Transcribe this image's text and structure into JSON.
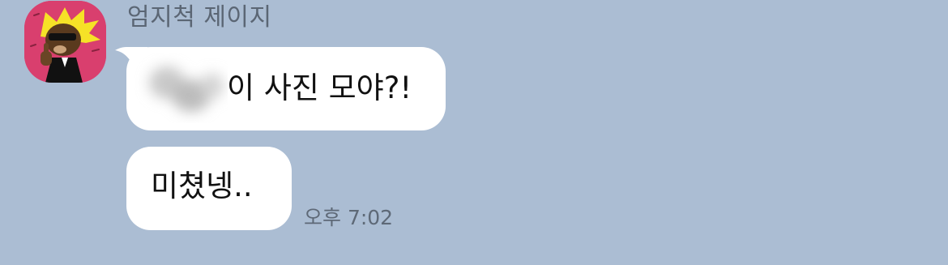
{
  "chat": {
    "sender": {
      "name": "엄지척 제이지",
      "avatar_icon": "thumbs-up-character-avatar"
    },
    "messages": [
      {
        "text": "이 사진 모야?!",
        "has_blurred_prefix": true
      },
      {
        "text": "미쳤넹.."
      }
    ],
    "timestamp": "오후 7:02"
  },
  "colors": {
    "background": "#abbdd3",
    "bubble": "#ffffff",
    "avatar_bg": "#d93f6e",
    "name_text": "#5b6674",
    "time_text": "#5e6977"
  }
}
